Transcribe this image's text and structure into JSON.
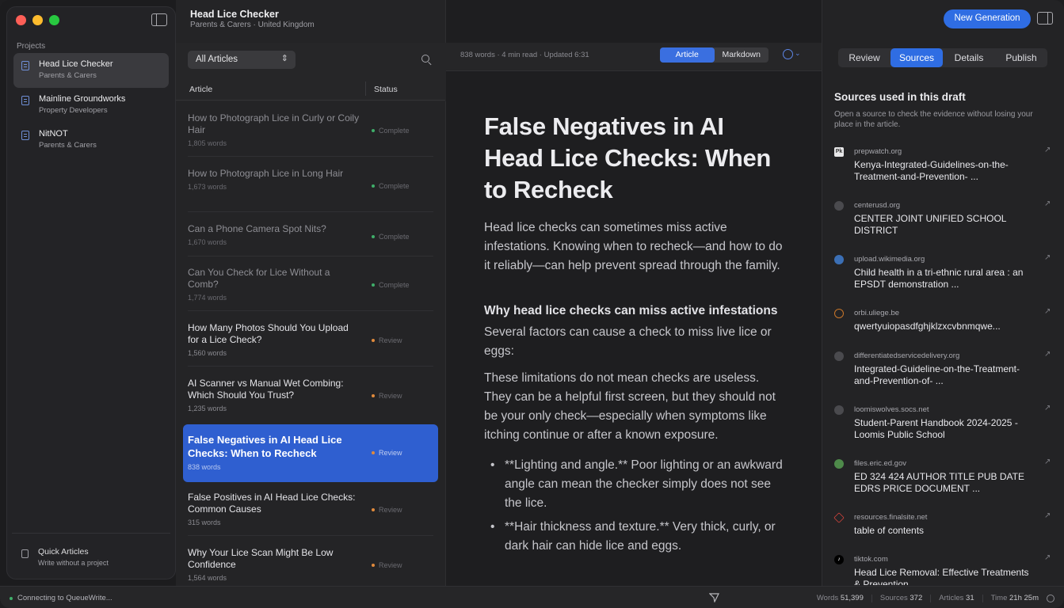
{
  "app": {
    "title": "Head Lice Checker",
    "subtitle": "Parents & Carers · United Kingdom"
  },
  "sidebar": {
    "section_label": "Projects",
    "projects": [
      {
        "title": "Head Lice Checker",
        "subtitle": "Parents & Carers"
      },
      {
        "title": "Mainline Groundworks",
        "subtitle": "Property Developers"
      },
      {
        "title": "NitNOT",
        "subtitle": "Parents & Carers"
      }
    ],
    "quick": {
      "title": "Quick Articles",
      "subtitle": "Write without a project"
    }
  },
  "list": {
    "filter": "All Articles",
    "col_article": "Article",
    "col_status": "Status",
    "rows": [
      {
        "title": "How to Photograph Lice in Curly or Coily Hair",
        "words": "1,805 words",
        "status": "Complete"
      },
      {
        "title": "How to Photograph Lice in Long Hair",
        "words": "1,673 words",
        "status": "Complete"
      },
      {
        "title": "Can a Phone Camera Spot Nits?",
        "words": "1,670 words",
        "status": "Complete"
      },
      {
        "title": "Can You Check for Lice Without a Comb?",
        "words": "1,774 words",
        "status": "Complete"
      },
      {
        "title": "How Many Photos Should You Upload for a Lice Check?",
        "words": "1,560 words",
        "status": "Review"
      },
      {
        "title": "AI Scanner vs Manual Wet Combing: Which Should You Trust?",
        "words": "1,235 words",
        "status": "Review"
      },
      {
        "title": "False Negatives in AI Head Lice Checks: When to Recheck",
        "words": "838 words",
        "status": "Review"
      },
      {
        "title": "False Positives in AI Head Lice Checks: Common Causes",
        "words": "315 words",
        "status": "Review"
      },
      {
        "title": "Why Your Lice Scan Might Be Low Confidence",
        "words": "1,564 words",
        "status": "Review"
      }
    ]
  },
  "editor": {
    "meta": "838 words · 4 min read · Updated 6:31",
    "mode_article": "Article",
    "mode_markdown": "Markdown",
    "title": "False Negatives in AI Head Lice Checks: When to Recheck",
    "lead": "Head lice checks can sometimes miss active infestations. Knowing when to recheck—and how to do it reliably—can help prevent spread through the family.",
    "h2": "Why head lice checks can miss active infestations",
    "p1": "Several factors can cause a check to miss live lice or eggs:",
    "p2": "These limitations do not mean checks are useless. They can be a helpful first screen, but they should not be your only check—especially when symptoms like itching continue or after a known exposure.",
    "bullets": [
      "**Lighting and angle.** Poor lighting or an awkward angle can mean the checker simply does not see the lice.",
      "**Hair thickness and texture.** Very thick, curly, or dark hair can hide lice and eggs."
    ]
  },
  "right": {
    "new_generation": "New Generation",
    "tabs": [
      "Review",
      "Sources",
      "Details",
      "Publish"
    ],
    "sources_title": "Sources used in this draft",
    "sources_desc": "Open a source to check the evidence without losing your place in the article.",
    "sources": [
      {
        "domain": "prepwatch.org",
        "title": "Kenya-Integrated-Guidelines-on-the-Treatment-and-Prevention- ...",
        "icon": "Pk"
      },
      {
        "domain": "centerusd.org",
        "title": "CENTER JOINT UNIFIED SCHOOL DISTRICT",
        "icon": ""
      },
      {
        "domain": "upload.wikimedia.org",
        "title": "Child health in a tri-ethnic rural area : an EPSDT demonstration ...",
        "icon": ""
      },
      {
        "domain": "orbi.uliege.be",
        "title": "qwertyuiopasdfghjklzxcvbnmqwe...",
        "icon": ""
      },
      {
        "domain": "differentiatedservicedelivery.org",
        "title": "Integrated-Guideline-on-the-Treatment-and-Prevention-of- ...",
        "icon": ""
      },
      {
        "domain": "loomiswolves.socs.net",
        "title": "Student-Parent Handbook 2024-2025 - Loomis Public School",
        "icon": ""
      },
      {
        "domain": "files.eric.ed.gov",
        "title": "ED 324 424 AUTHOR TITLE PUB DATE EDRS PRICE DOCUMENT ...",
        "icon": ""
      },
      {
        "domain": "resources.finalsite.net",
        "title": "table of contents",
        "icon": ""
      },
      {
        "domain": "tiktok.com",
        "title": "Head Lice Removal: Effective Treatments & Prevention",
        "icon": ""
      }
    ]
  },
  "statusbar": {
    "connection": "Connecting to QueueWrite...",
    "words_label": "Words",
    "words": "51,399",
    "sources_label": "Sources",
    "sources": "372",
    "articles_label": "Articles",
    "articles": "31",
    "time_label": "Time",
    "time": "21h 25m"
  },
  "colors": {
    "accent": "#2f6de3",
    "complete": "#3fae6a",
    "review": "#e08a3c"
  }
}
